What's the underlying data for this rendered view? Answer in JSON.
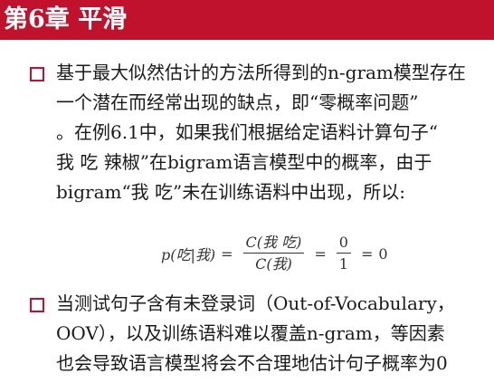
{
  "slide": {
    "title": "第6章 平滑",
    "colors": {
      "title_bar": "#c0122d",
      "bullet": "#c0122d",
      "text": "#1a1a1a"
    },
    "bullets": [
      {
        "icon": "hollow-square-bullet",
        "lines": [
          "基于最大似然估计的方法所得到的n-gram模型存在",
          "一个潜在而经常出现的缺点，即“零概率问题”",
          "。在例6.1中，如果我们根据给定语料计算句子“",
          "我 吃 辣椒”在bigram语言模型中的概率，由于",
          "bigram“我 吃”未在训练语料中出现，所以:"
        ]
      },
      {
        "icon": "hollow-square-bullet",
        "lines": [
          "当测试句子含有未登录词（Out-of-Vocabulary，",
          "OOV），以及训练语料难以覆盖n-gram，等因素",
          "也会导致语言模型将会不合理地估计句子概率为0"
        ]
      }
    ],
    "formula": {
      "lhs": "p(吃|我)",
      "eq1": "=",
      "frac1_num": "C(我 吃)",
      "frac1_den": "C(我)",
      "eq2": "=",
      "frac2_num": "0",
      "frac2_den": "1",
      "eq3": "=",
      "result": "0"
    }
  }
}
